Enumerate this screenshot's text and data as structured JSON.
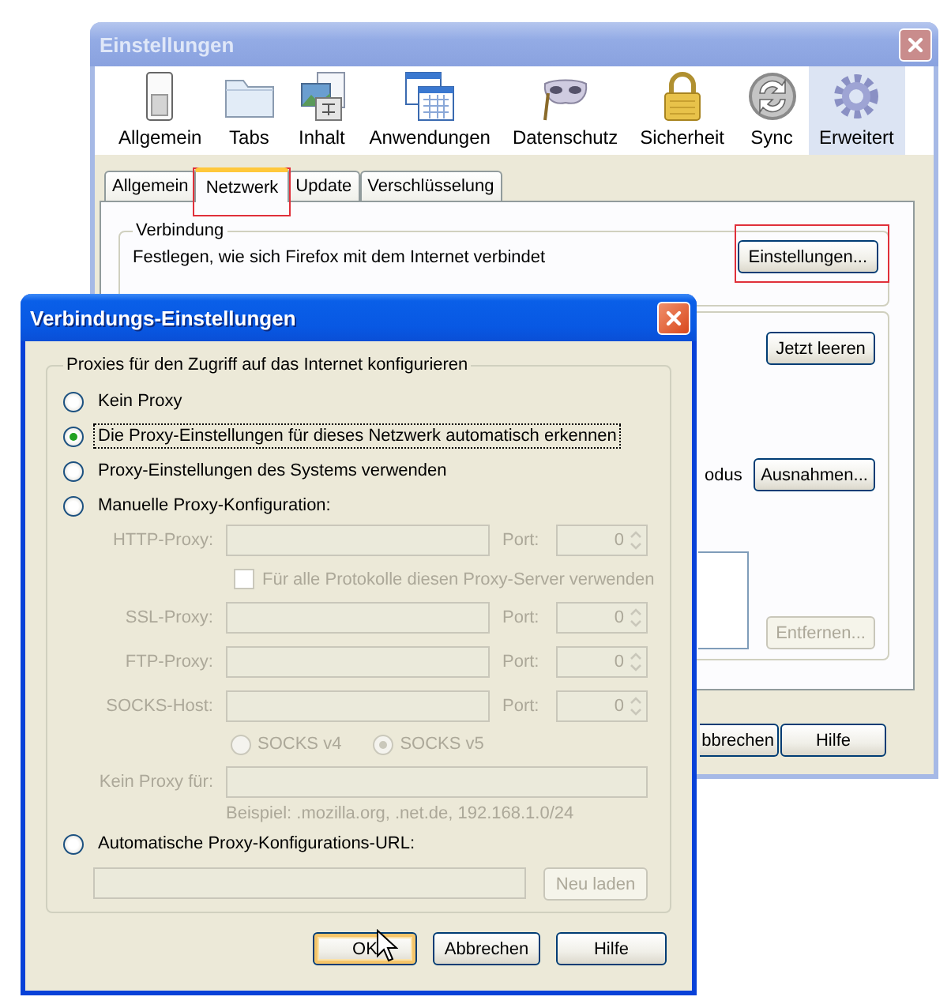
{
  "settings_window": {
    "title": "Einstellungen",
    "active": false,
    "toolbar": [
      {
        "label": "Allgemein",
        "kind": "switch",
        "selected": false
      },
      {
        "label": "Tabs",
        "kind": "folder",
        "selected": false
      },
      {
        "label": "Inhalt",
        "kind": "document",
        "selected": false
      },
      {
        "label": "Anwendungen",
        "kind": "windows",
        "selected": false
      },
      {
        "label": "Datenschutz",
        "kind": "mask",
        "selected": false
      },
      {
        "label": "Sicherheit",
        "kind": "padlock",
        "selected": false
      },
      {
        "label": "Sync",
        "kind": "sync",
        "selected": false
      },
      {
        "label": "Erweitert",
        "kind": "gear",
        "selected": true
      }
    ],
    "tabs": [
      {
        "label": "Allgemein",
        "selected": false,
        "highlighted": false
      },
      {
        "label": "Netzwerk",
        "selected": true,
        "highlighted": true
      },
      {
        "label": "Update",
        "selected": false,
        "highlighted": false
      },
      {
        "label": "Verschlüsselung",
        "selected": false,
        "highlighted": false
      }
    ],
    "connection": {
      "legend": "Verbindung",
      "text": "Festlegen, wie sich Firefox mit dem Internet verbindet",
      "button": {
        "label": "Einstellungen...",
        "highlighted": true
      }
    },
    "cache_buttons": [
      {
        "label": "Jetzt leeren",
        "disabled": false
      },
      {
        "label": "Ausnahmen...",
        "disabled": false
      },
      {
        "label": "Entfernen...",
        "disabled": true
      }
    ],
    "partial_label": "odus",
    "footer_buttons": [
      {
        "label": "bbrechen"
      },
      {
        "label": "Hilfe"
      }
    ]
  },
  "proxy_dialog": {
    "title": "Verbindungs-Einstellungen",
    "active": true,
    "legend": "Proxies für den Zugriff auf das Internet konfigurieren",
    "modes": [
      {
        "label": "Kein Proxy",
        "selected": false,
        "focused": false
      },
      {
        "label": "Die Proxy-Einstellungen für dieses Netzwerk automatisch erkennen",
        "selected": true,
        "focused": true
      },
      {
        "label": "Proxy-Einstellungen des Systems verwenden",
        "selected": false,
        "focused": false
      },
      {
        "label": "Manuelle Proxy-Konfiguration:",
        "selected": false,
        "focused": false
      },
      {
        "label": "Automatische Proxy-Konfigurations-URL:",
        "selected": false,
        "focused": false
      }
    ],
    "manual": {
      "disabled": true,
      "proxies": [
        {
          "label": "HTTP-Proxy:",
          "port_label": "Port:",
          "port": "0"
        },
        {
          "label": "SSL-Proxy:",
          "port_label": "Port:",
          "port": "0"
        },
        {
          "label": "FTP-Proxy:",
          "port_label": "Port:",
          "port": "0"
        },
        {
          "label": "SOCKS-Host:",
          "port_label": "Port:",
          "port": "0"
        }
      ],
      "share_all": {
        "label": "Für alle Protokolle diesen Proxy-Server verwenden",
        "checked": false
      },
      "socks_versions": [
        {
          "label": "SOCKS v4",
          "selected": false
        },
        {
          "label": "SOCKS v5",
          "selected": true
        }
      ],
      "no_proxy_label": "Kein Proxy für:",
      "example": "Beispiel: .mozilla.org, .net.de, 192.168.1.0/24"
    },
    "reload_button": {
      "label": "Neu laden",
      "disabled": true
    },
    "buttons": [
      {
        "label": "OK",
        "focused": true
      },
      {
        "label": "Abbrechen",
        "focused": false
      },
      {
        "label": "Hilfe",
        "focused": false
      }
    ]
  }
}
